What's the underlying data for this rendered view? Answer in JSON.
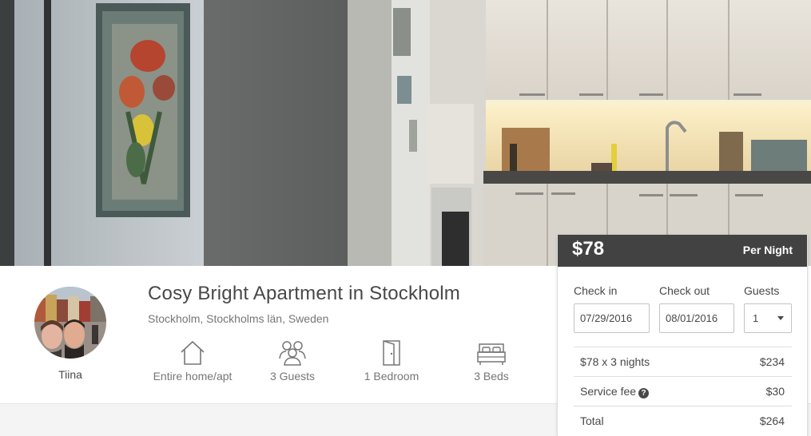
{
  "listing": {
    "title": "Cosy Bright Apartment in Stockholm",
    "location": "Stockholm, Stockholms län, Sweden",
    "host_name": "Tiina"
  },
  "features": [
    {
      "label": "Entire home/apt",
      "icon": "house-icon"
    },
    {
      "label": "3 Guests",
      "icon": "guests-icon"
    },
    {
      "label": "1 Bedroom",
      "icon": "door-icon"
    },
    {
      "label": "3 Beds",
      "icon": "bed-icon"
    }
  ],
  "booking": {
    "price": "$78",
    "per_night": "Per Night",
    "checkin_label": "Check in",
    "checkout_label": "Check out",
    "guests_label": "Guests",
    "checkin_value": "07/29/2016",
    "checkout_value": "08/01/2016",
    "guests_value": "1",
    "nights_label": "$78 x 3 nights",
    "nights_total": "$234",
    "fee_label": "Service fee",
    "fee_icon": "question-icon",
    "fee_value": "$30",
    "total_label": "Total",
    "total_value": "$264"
  },
  "colors": {
    "price_bar": "#323232",
    "text": "#484848",
    "muted": "#767676",
    "border": "#dce0e0"
  }
}
